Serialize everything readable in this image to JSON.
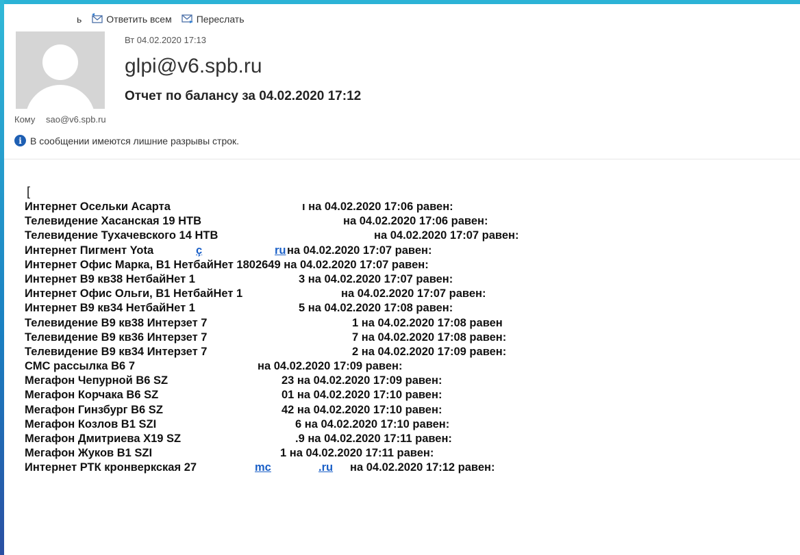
{
  "toolbar": {
    "truncated_label": "ь",
    "reply_all_label": "Ответить всем",
    "forward_label": "Переслать"
  },
  "header": {
    "date": "Вт 04.02.2020 17:13",
    "sender": "glpi@v6.spb.ru",
    "subject": "Отчет по балансу за  04.02.2020 17:12",
    "to_label": "Кому",
    "to_address": "sao@v6.spb.ru",
    "info_icon": "info-icon",
    "info_text": "В сообщении имеются лишние разрывы строк."
  },
  "body": {
    "open_bracket": "[",
    "lines": [
      {
        "left": "Интернет Осельки Асарта",
        "right": "ı на  04.02.2020 17:06 равен:"
      },
      {
        "left": "Телевидение Хасанская 19 НТВ",
        "right": "на  04.02.2020 17:06 равен:"
      },
      {
        "left": "Телевидение Тухачевского 14 НТВ",
        "right": "на  04.02.2020 17:07 равен:"
      },
      {
        "left": "Интернет Пигмент Yota",
        "link1": "ç",
        "link2": "ru",
        "right": "на  04.02.2020 17:07 равен:"
      },
      {
        "left": "Интернет Офис Марка, В1 НетбайНет 1802649 на  04.02.2020 17:07 равен:"
      },
      {
        "left": "Интернет В9 кв38 НетбайНет 1",
        "right": "3 на  04.02.2020 17:07 равен:"
      },
      {
        "left": "Интернет Офис Ольги, В1 НетбайНет 1",
        "right": "на  04.02.2020 17:07 равен:"
      },
      {
        "left": "Интернет В9 кв34 НетбайНет 1",
        "right": "5 на  04.02.2020 17:08 равен:"
      },
      {
        "left": "Телевидение В9 кв38 Интерзет 7",
        "right": "1 на  04.02.2020 17:08 равен"
      },
      {
        "left": "Телевидение В9 кв36 Интерзет 7",
        "right": "7 на  04.02.2020 17:08 равен:"
      },
      {
        "left": "Телевидение В9 кв34 Интерзет 7",
        "right": "2 на  04.02.2020 17:09 равен:"
      },
      {
        "left": "СМС рассылка В6 7",
        "right": "на  04.02.2020 17:09 равен:"
      },
      {
        "left": "Мегафон Чепурной В6 SZ",
        "right": "23 на  04.02.2020 17:09 равен:"
      },
      {
        "left": "Мегафон Корчака В6 SZ",
        "right": "01 на  04.02.2020 17:10 равен:"
      },
      {
        "left": "Мегафон Гинзбург В6 SZ",
        "right": "42 на  04.02.2020 17:10 равен:"
      },
      {
        "left": "Мегафон Козлов В1 SZI",
        "right": "6 на  04.02.2020 17:10 равен:"
      },
      {
        "left": "Мегафон Дмитриева Х19 SZ",
        "right": ".9 на  04.02.2020 17:11 равен:"
      },
      {
        "left": "Мегафон Жуков В1 SZI",
        "right": "1 на  04.02.2020 17:11 равен:"
      },
      {
        "left": "Интернет РТК кронверкская 27",
        "link1": "mc",
        "link2": ".ru",
        "right": "на  04.02.2020 17:12 равен:"
      }
    ]
  }
}
